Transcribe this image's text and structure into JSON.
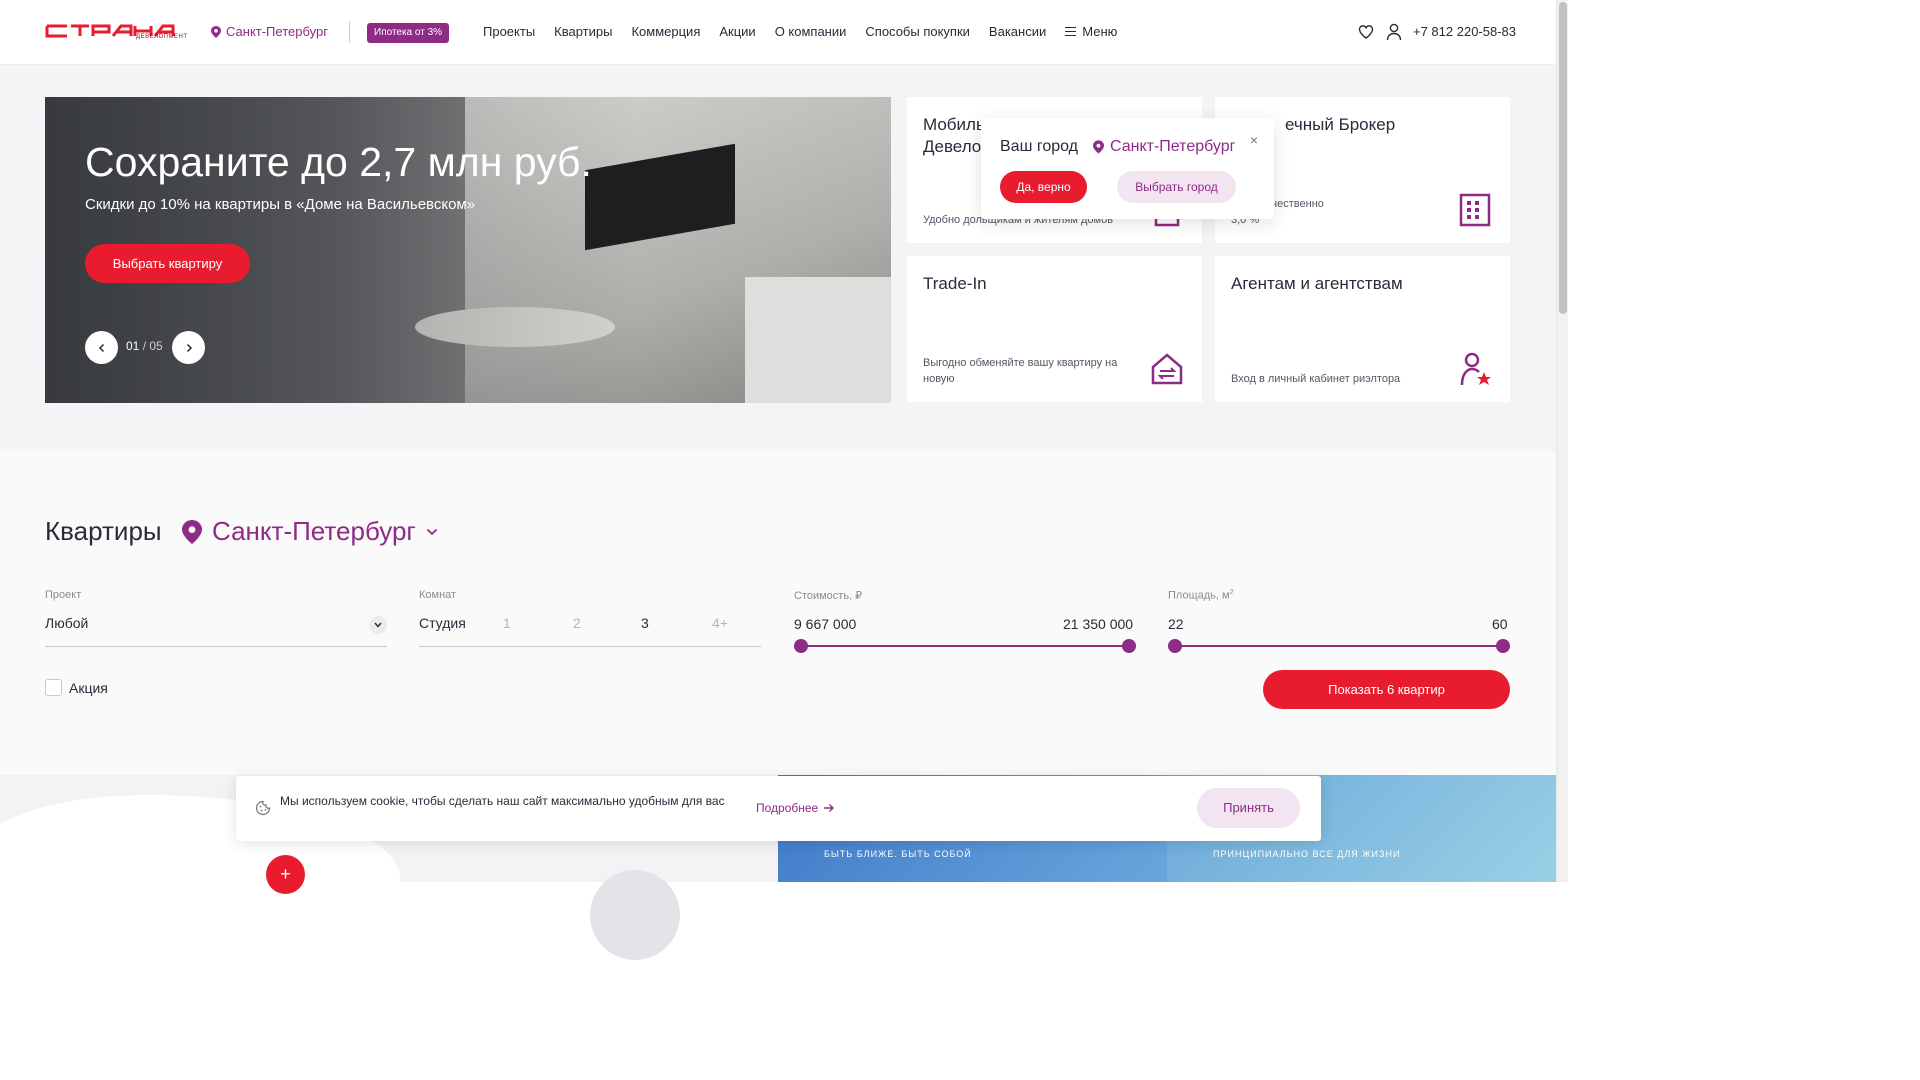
{
  "header": {
    "logo_alt": "СТРАНА девелопмент",
    "logo_sub": "ДЕВЕЛОПМЕНТ",
    "city": "Санкт-Петербург",
    "mortgage_badge": "Ипотека от 3%",
    "nav": [
      "Проекты",
      "Квартиры",
      "Коммерция",
      "Акции",
      "О компании",
      "Способы покупки",
      "Вакансии"
    ],
    "menu_label": "Меню",
    "phone": "+7 812 220-58-83"
  },
  "hero": {
    "title": "Сохраните до 2,7 млн руб.",
    "subtitle": "Скидки до 10% на квартиры в «Доме на Васильевском»",
    "button": "Выбрать квартиру",
    "slide_current": "01",
    "slide_sep": " / ",
    "slide_total": "05"
  },
  "cards": [
    {
      "title": "Мобильный Девелопер",
      "title_visible": "Мобиль\nДевело",
      "desc": "Удобно дольщикам и жителям домов"
    },
    {
      "title": "Ипотечный Брокер",
      "title_visible": "ечный Брокер",
      "desc": "тно и качественно\n3,0 %"
    },
    {
      "title": "Trade-In",
      "desc": "Выгодно обменяйте вашу квартиру на новую"
    },
    {
      "title": "Агентам и агентствам",
      "desc": "Вход в личный кабинет риэлтора"
    }
  ],
  "city_popup": {
    "question": "Ваш город",
    "city": "Санкт-Петербург",
    "yes": "Да, верно",
    "choose": "Выбрать город",
    "close": "×"
  },
  "filters": {
    "title": "Квартиры",
    "city": "Санкт-Петербург",
    "project_label": "Проект",
    "project_value": "Любой",
    "rooms_label": "Комнат",
    "rooms": [
      "Студия",
      "1",
      "2",
      "3",
      "4+"
    ],
    "rooms_active": [
      "Студия",
      "3"
    ],
    "price_label": "Стоимость, ₽",
    "price_min": "9 667 000",
    "price_max": "21 350 000",
    "area_label": "Площадь, м",
    "area_label_sup": "2",
    "area_min": "22",
    "area_max": "60",
    "promo_label": "Акция",
    "show_button": "Показать 6 квартир"
  },
  "promos": [
    {
      "text": "БЫТЬ БЛИЖЕ. БЫТЬ СОБОЙ"
    },
    {
      "text": "ПРИНЦИПИАЛЬНО ВСЕ ДЛЯ ЖИЗНИ"
    }
  ],
  "cookie": {
    "text": "Мы используем cookie, чтобы сделать наш сайт максимально удобным для вас",
    "more": "Подробнее",
    "accept": "Принять"
  },
  "map": {
    "plus": "+"
  },
  "colors": {
    "brand": "#8e2b86",
    "accent": "#e81c2e",
    "text": "#2a2a3a"
  },
  "icons": [
    "location-pin-icon",
    "heart-icon",
    "user-icon",
    "menu-icon",
    "chevron-left-icon",
    "chevron-right-icon",
    "building-icon",
    "house-exchange-icon",
    "agent-star-icon",
    "chevron-down-icon",
    "cookie-icon",
    "arrow-right-icon",
    "close-icon"
  ]
}
